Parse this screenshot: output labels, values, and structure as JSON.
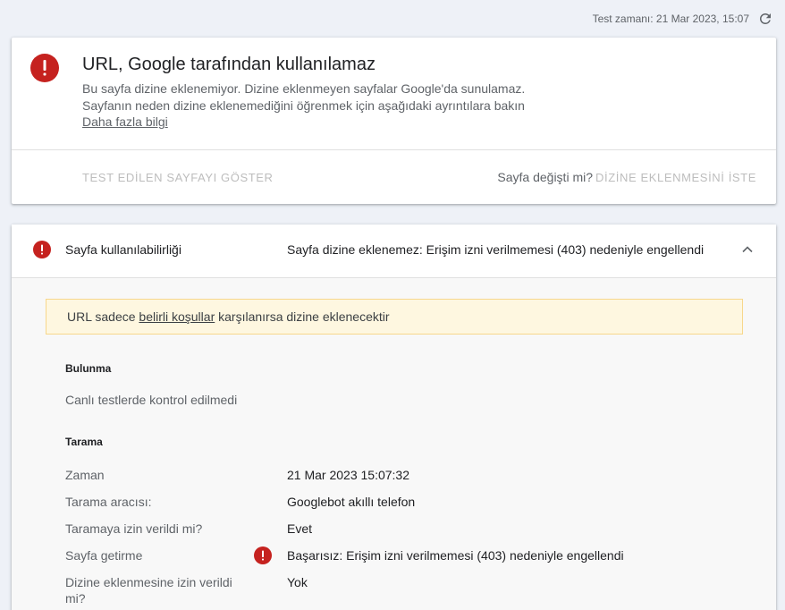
{
  "topbar": {
    "test_time": "Test zamanı: 21 Mar 2023, 15:07",
    "refresh_icon": "refresh-icon"
  },
  "status_card": {
    "icon": "error-icon",
    "title": "URL, Google tarafından kullanılamaz",
    "desc_line1": "Bu sayfa dizine eklenemiyor. Dizine eklenmeyen sayfalar Google'da sunulamaz.",
    "desc_line2": "Sayfanın neden dizine eklenemediğini öğrenmek için aşağıdaki ayrıntılara bakın",
    "learn_more": "Daha fazla bilgi",
    "show_tested_page": "TEST EDİLEN SAYFAYI GÖSTER",
    "page_changed": "Sayfa değişti mi?",
    "request_indexing": "DİZİNE EKLENMESİNİ İSTE"
  },
  "detail_card": {
    "header_label": "Sayfa kullanılabilirliği",
    "header_status": "Sayfa dizine eklenemez: Erişim izni verilmemesi (403) nedeniyle engellendi",
    "notice_prefix": "URL sadece ",
    "notice_link": "belirli koşullar",
    "notice_suffix": " karşılanırsa dizine eklenecektir",
    "discovery_title": "Bulunma",
    "discovery_text": "Canlı testlerde kontrol edilmedi",
    "crawl_title": "Tarama",
    "rows": [
      {
        "label": "Zaman",
        "value": "21 Mar 2023 15:07:32"
      },
      {
        "label": "Tarama aracısı:",
        "value": "Googlebot akıllı telefon"
      },
      {
        "label": "Taramaya izin verildi mi?",
        "value": "Evet"
      },
      {
        "label": "Sayfa getirme",
        "value": "Başarısız: Erişim izni verilmemesi (403) nedeniyle engellendi"
      },
      {
        "label": "Dizine eklenmesine izin verildi mi?",
        "value": "Yok"
      }
    ]
  },
  "colors": {
    "error": "#c5221f",
    "notice_bg": "#fef7e0",
    "notice_border": "#f7d78c",
    "background": "#eef1f7"
  }
}
